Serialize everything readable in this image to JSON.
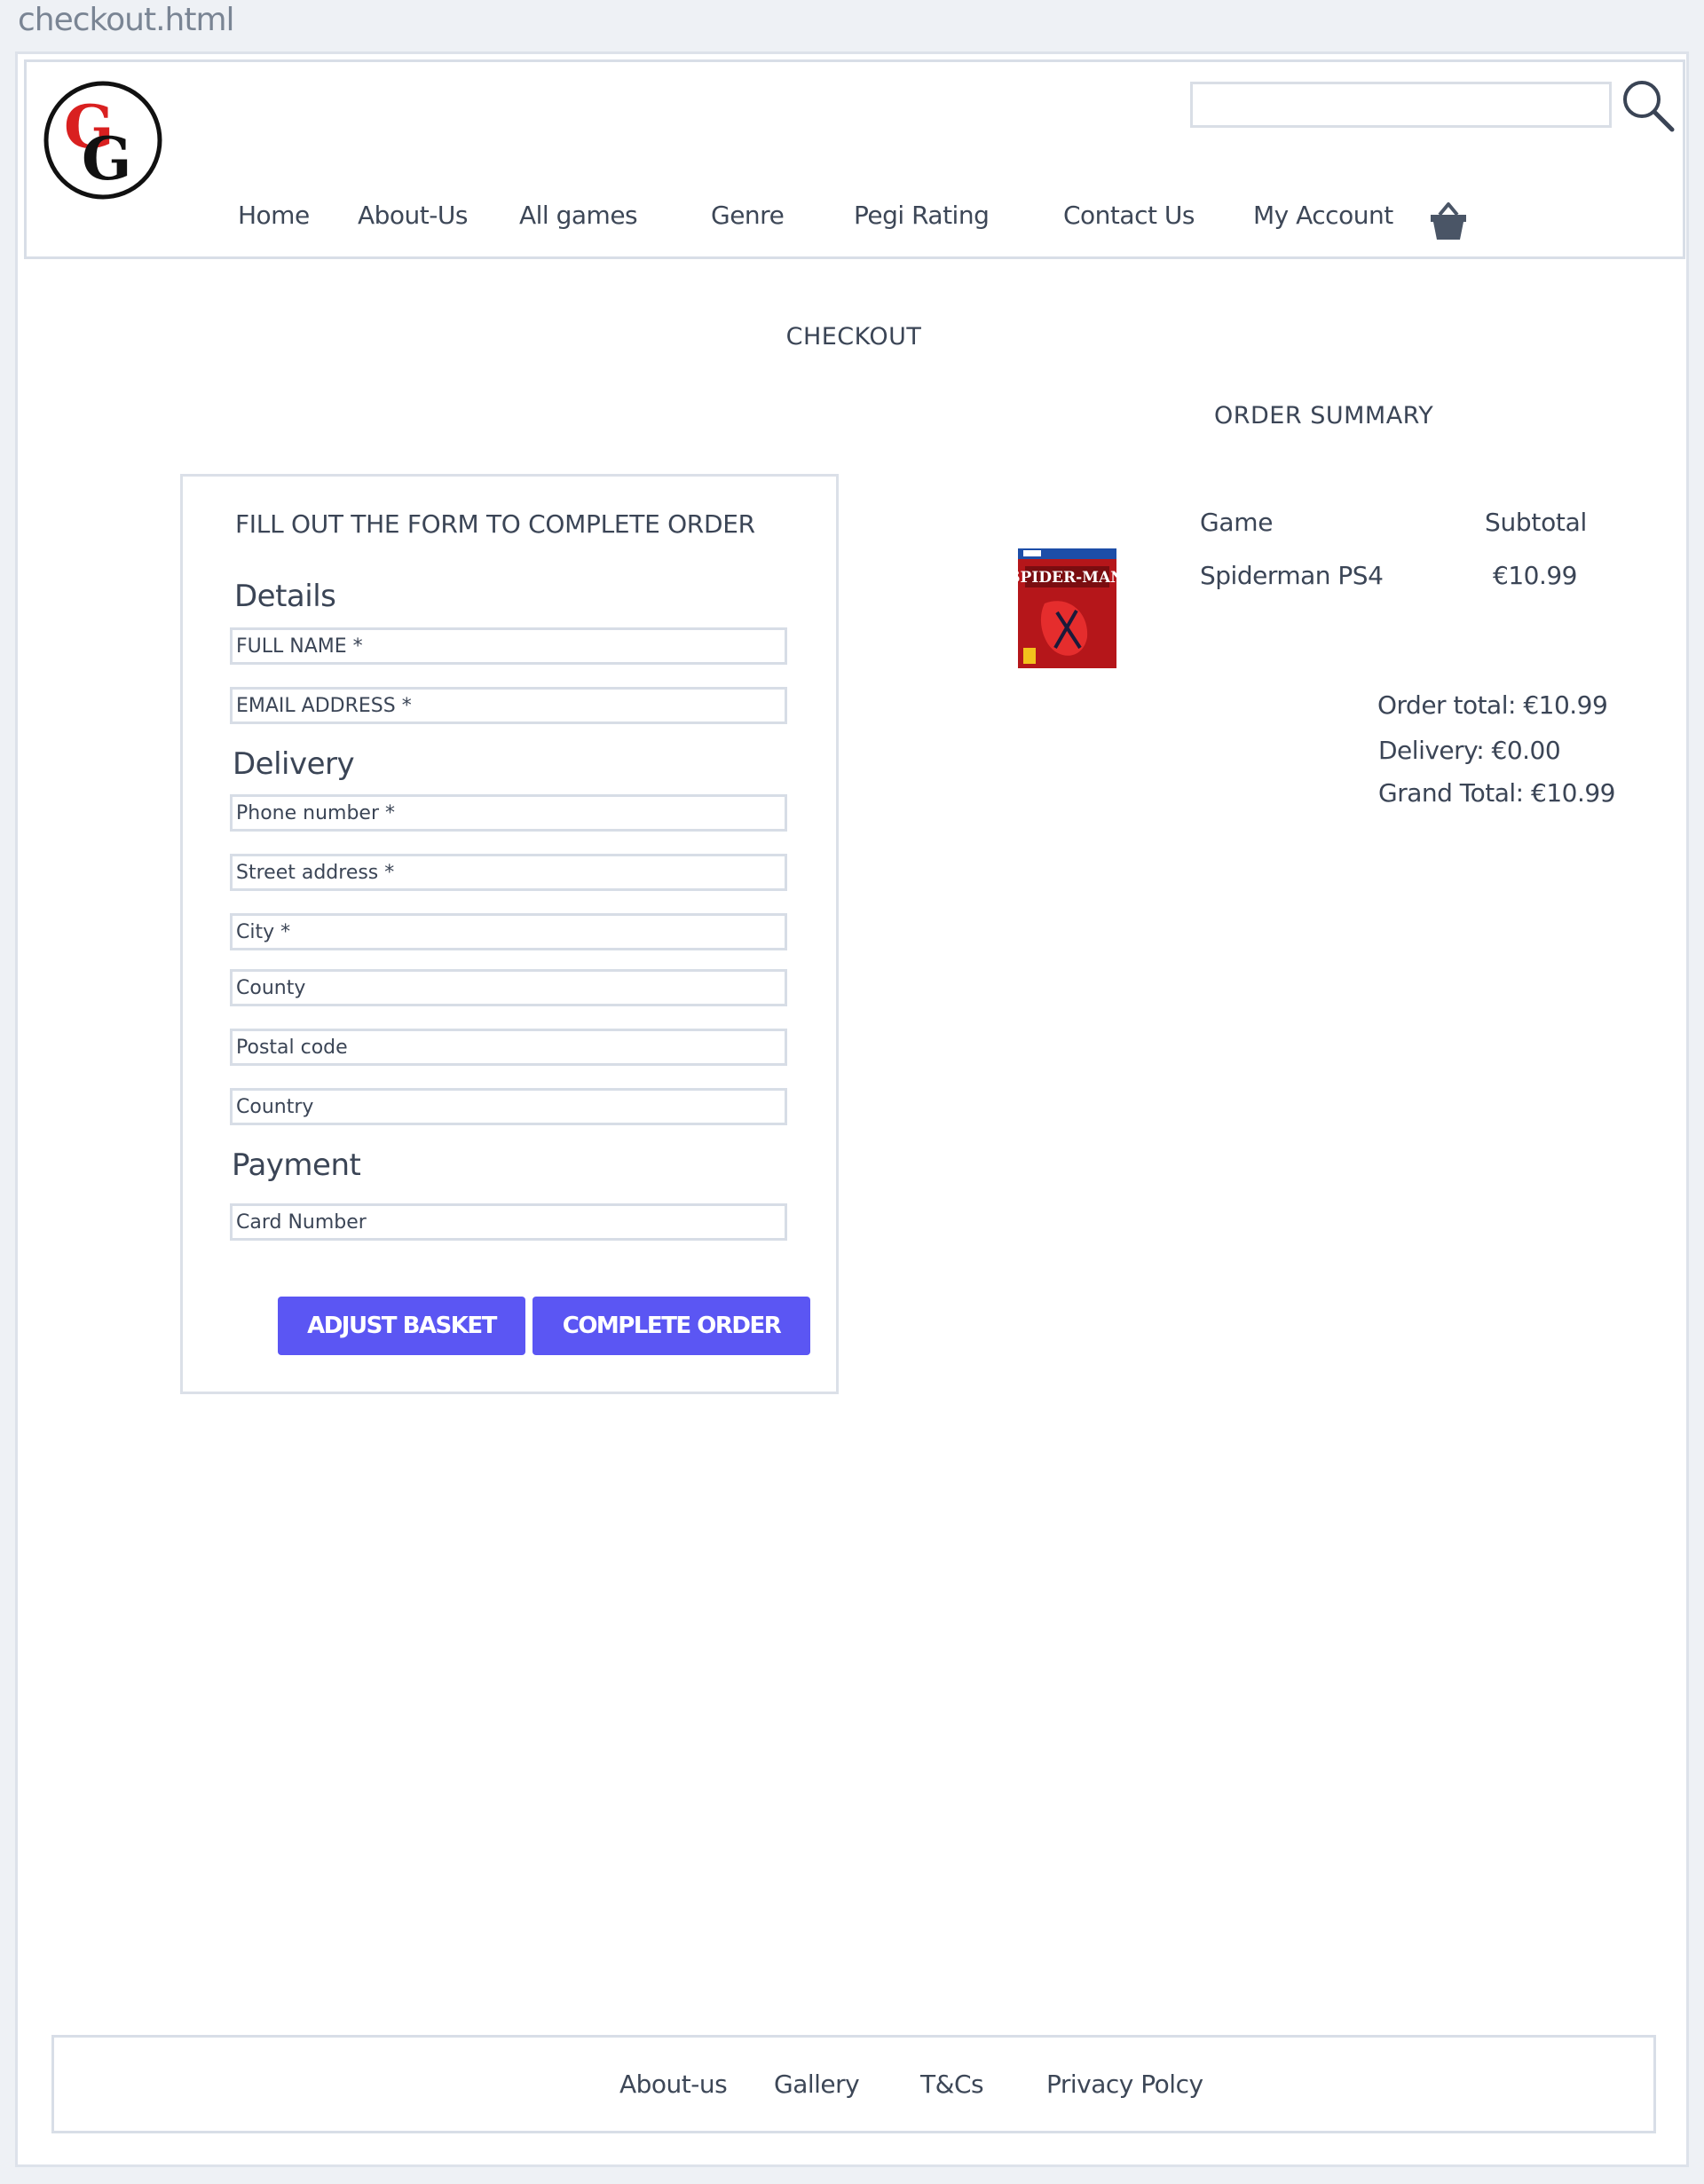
{
  "window": {
    "file_name": "checkout.html"
  },
  "header": {
    "logo_letters": "GG",
    "search": {
      "value": "",
      "placeholder": ""
    },
    "nav": [
      {
        "label": "Home"
      },
      {
        "label": "About-Us"
      },
      {
        "label": "All games"
      },
      {
        "label": "Genre"
      },
      {
        "label": "Pegi Rating"
      },
      {
        "label": "Contact Us"
      },
      {
        "label": "My Account"
      }
    ],
    "icons": [
      "search-icon",
      "basket-icon"
    ]
  },
  "page": {
    "title": "CHECKOUT",
    "summary_title": "ORDER SUMMARY"
  },
  "form": {
    "title": "FILL OUT THE FORM TO COMPLETE ORDER",
    "sections": {
      "details": "Details",
      "delivery": "Delivery",
      "payment": "Payment"
    },
    "fields": {
      "full_name": {
        "placeholder": "FULL NAME *",
        "value": ""
      },
      "email": {
        "placeholder": "EMAIL ADDRESS *",
        "value": ""
      },
      "phone": {
        "placeholder": "Phone number *",
        "value": ""
      },
      "street": {
        "placeholder": "Street address *",
        "value": ""
      },
      "city": {
        "placeholder": "City *",
        "value": ""
      },
      "county": {
        "placeholder": "County",
        "value": ""
      },
      "postal": {
        "placeholder": "Postal code",
        "value": ""
      },
      "country": {
        "placeholder": "Country",
        "value": ""
      },
      "card": {
        "placeholder": "Card Number",
        "value": ""
      }
    },
    "buttons": {
      "adjust": "ADJUST BASKET",
      "complete": "COMPLETE ORDER"
    },
    "accent_color": "#5b56f3"
  },
  "summary": {
    "columns": {
      "game": "Game",
      "subtotal": "Subtotal"
    },
    "items": [
      {
        "name": "Spiderman PS4",
        "subtotal": "€10.99",
        "image_icon": "spiderman-ps4-cover"
      }
    ],
    "order_total": "Order total: €10.99",
    "delivery": "Delivery: €0.00",
    "grand_total": "Grand Total: €10.99"
  },
  "footer": {
    "links": [
      {
        "label": "About-us"
      },
      {
        "label": "Gallery"
      },
      {
        "label": "T&Cs"
      },
      {
        "label": "Privacy Polcy"
      }
    ]
  }
}
